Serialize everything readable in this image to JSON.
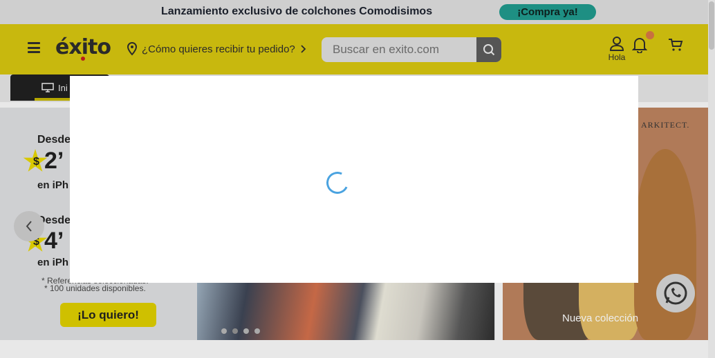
{
  "promo": {
    "text": "Lanzamiento exclusivo de colchones Comodisimos",
    "button_label": "¡Compra ya!"
  },
  "header": {
    "logo": "éxito",
    "delivery_prompt": "¿Cómo quieres recibir tu pedido?",
    "search_placeholder": "Buscar en exito.com",
    "user_label": "Hola"
  },
  "nav": {
    "first_label": "Ini",
    "more_label": "n"
  },
  "hero": {
    "line1": "Desde",
    "price1_symbol": "$",
    "price1": "2’",
    "line1b": "en iPh",
    "line2": "Desde",
    "price2_symbol": "$",
    "price2": "4’",
    "line2b": "en iPh",
    "note1": "* Referencias seleccionadas.",
    "note2": "* 100 unidades disponibles.",
    "cta_label": "¡Lo quiero!",
    "brand": "ARKITECT.",
    "collection_label": "Nueva colección"
  },
  "colors": {
    "header_bg": "#c8b80e",
    "promo_button": "#1e8f83",
    "spinner": "#4aa3e0"
  },
  "icons": [
    "menu-icon",
    "location-pin-icon",
    "chevron-right-icon",
    "search-icon",
    "user-icon",
    "bell-icon",
    "cart-icon",
    "monitor-icon",
    "chevron-left-icon",
    "whatsapp-icon",
    "loading-spinner-icon"
  ]
}
